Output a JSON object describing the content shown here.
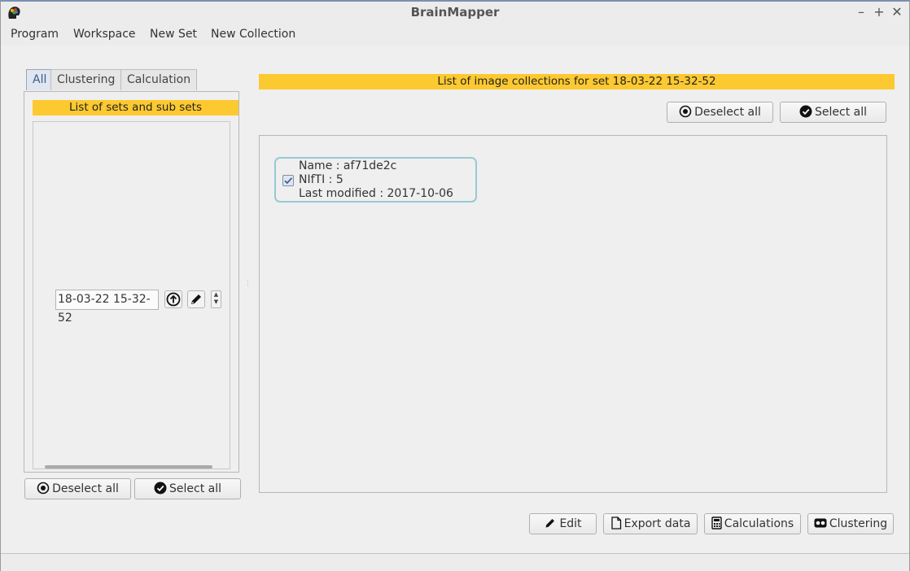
{
  "window": {
    "title": "BrainMapper",
    "controls": {
      "minimize": "–",
      "maximize": "+",
      "close": "✕"
    }
  },
  "menu": {
    "items": [
      {
        "label": "Program"
      },
      {
        "label": "Workspace"
      },
      {
        "label": "New Set"
      },
      {
        "label": "New Collection"
      }
    ]
  },
  "left": {
    "tabs": [
      {
        "label": "All"
      },
      {
        "label": "Clustering"
      },
      {
        "label": "Calculation"
      }
    ],
    "header": "List of sets and sub sets",
    "set_name": "18-03-22 15-32-52",
    "deselect_label": "Deselect all",
    "select_label": "Select all"
  },
  "main": {
    "header": "List of image collections for set 18-03-22 15-32-52",
    "deselect_label": "Deselect all",
    "select_label": "Select all",
    "collection": {
      "name_line": "Name : af71de2c",
      "nifti_line": "NIfTI : 5",
      "modified_line": "Last modified : 2017-10-06",
      "checked": true
    }
  },
  "actions": {
    "edit": "Edit",
    "export": "Export data",
    "calculations": "Calculations",
    "clustering": "Clustering"
  },
  "colors": {
    "accent_yellow": "#fdc930",
    "card_border": "#97c9d6"
  }
}
